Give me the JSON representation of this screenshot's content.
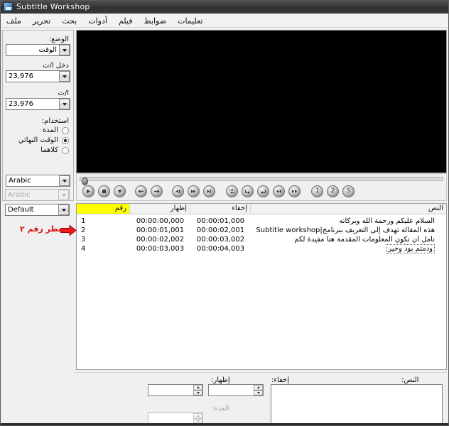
{
  "window": {
    "title": "Subtitle Workshop",
    "icon": "app-icon"
  },
  "menubar": {
    "items": [
      {
        "label": "ملف"
      },
      {
        "label": "تحرير"
      },
      {
        "label": "بحث"
      },
      {
        "label": "أدوات"
      },
      {
        "label": "فيلم"
      },
      {
        "label": "ضوابط"
      },
      {
        "label": "تعليمات"
      }
    ]
  },
  "left_panel": {
    "mode_label": "الوضع:",
    "mode_value": "الوقت",
    "input_fps_label": "دخل ا/ث",
    "input_fps_value": "23,976",
    "fps_label": "ا/ث",
    "fps_value": "23,976",
    "use_label": "استخدام:",
    "radios": [
      {
        "label": "المدة",
        "checked": false
      },
      {
        "label": "الوقت النهائي",
        "checked": true
      },
      {
        "label": "كلاهما",
        "checked": false
      }
    ],
    "combo_language": "Arabic",
    "combo_language2": "Arabic",
    "combo_style": "Default"
  },
  "player": {
    "seek_position": 0,
    "buttons": [
      {
        "name": "play-button",
        "glyph": "play"
      },
      {
        "name": "stop-button",
        "glyph": "stop"
      },
      {
        "name": "mark-button",
        "glyph": "down"
      },
      {
        "name": "rewind-button",
        "glyph": "left"
      },
      {
        "name": "forward-button",
        "glyph": "right"
      },
      {
        "name": "prev-frame-button",
        "glyph": "prevframe"
      },
      {
        "name": "next-frame-button",
        "glyph": "nextframe"
      },
      {
        "name": "step-button",
        "glyph": "step"
      },
      {
        "name": "sync-button",
        "glyph": "sync"
      },
      {
        "name": "set-start-button",
        "glyph": "cw"
      },
      {
        "name": "set-end-button",
        "glyph": "ccw"
      },
      {
        "name": "move-back-button",
        "glyph": "dleft"
      },
      {
        "name": "move-forward-button",
        "glyph": "dright"
      },
      {
        "name": "marker-1-button",
        "glyph": "1"
      },
      {
        "name": "marker-2-button",
        "glyph": "2"
      },
      {
        "name": "marker-s-button",
        "glyph": "S"
      }
    ]
  },
  "subtitle_list": {
    "columns": [
      {
        "key": "num",
        "label": "رقم",
        "highlight": true
      },
      {
        "key": "show",
        "label": "إظهار",
        "highlight": false
      },
      {
        "key": "hide",
        "label": "إخفاء",
        "highlight": false
      },
      {
        "key": "text",
        "label": "النص",
        "highlight": false
      }
    ],
    "rows": [
      {
        "num": "1",
        "show": "00:00:00,000",
        "hide": "00:00:01,000",
        "text": "السلام عليكم ورحمة الله وبركاته",
        "focused": false
      },
      {
        "num": "2",
        "show": "00:00:01,001",
        "hide": "00:00:02,001",
        "text": "هذه المقالة تهدف إلى التعريف ببرنامج|Subtitle workshop",
        "focused": false
      },
      {
        "num": "3",
        "show": "00:00:02,002",
        "hide": "00:00:03,002",
        "text": "نأمل أن تكون المعلومات المقدمة هنا مفيدة لكم",
        "focused": false
      },
      {
        "num": "4",
        "show": "00:00:03,003",
        "hide": "00:00:04,003",
        "text": "ودمتم بود وخير",
        "focused": true
      }
    ]
  },
  "annotation": {
    "text": "سطر رقم ٢",
    "color": "#d81010",
    "arrow": "right-arrow-icon"
  },
  "bottom_panel": {
    "show_label": "إظهار:",
    "show_value": "",
    "hide_label": "إخفاء:",
    "hide_value": "",
    "duration_label": "المدة:",
    "duration_value": "",
    "text_label": "النص:",
    "text_value": ""
  },
  "colors": {
    "highlight": "#ffff00",
    "annotation": "#d81010",
    "titlebar": "#3a3a3a",
    "video": "#000000"
  }
}
